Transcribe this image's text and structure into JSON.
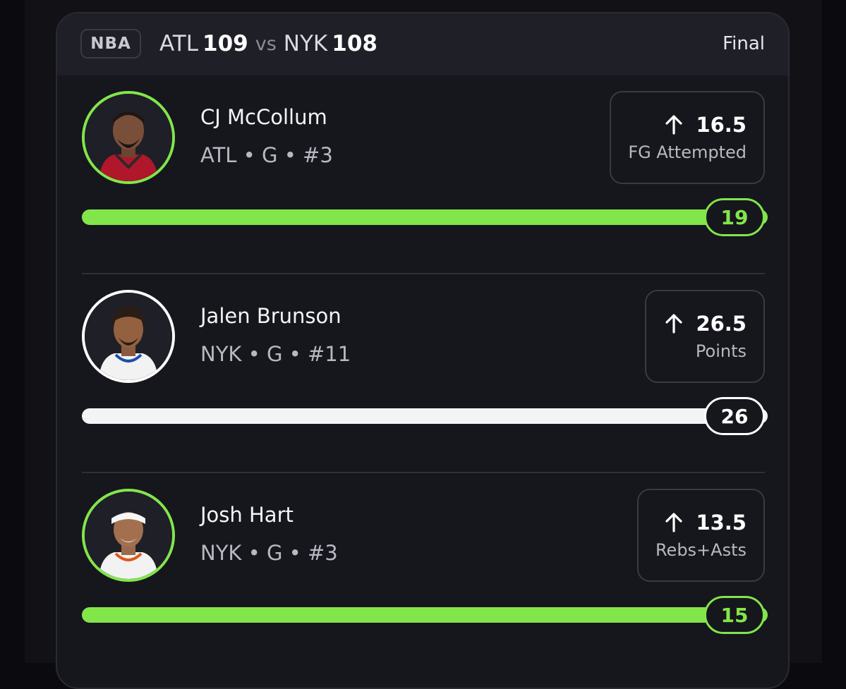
{
  "game": {
    "league": "NBA",
    "away_team": "ATL",
    "away_score": "109",
    "vs": "vs",
    "home_team": "NYK",
    "home_score": "108",
    "status": "Final"
  },
  "colors": {
    "hit": "#82e64a",
    "push": "#ffffff"
  },
  "players": [
    {
      "name": "CJ McCollum",
      "meta": "ATL • G • #3",
      "line": "16.5",
      "stat": "FG Attempted",
      "direction_icon": "arrow-up-icon",
      "result": "19",
      "result_state": "hit",
      "progress_fraction": 1.0
    },
    {
      "name": "Jalen Brunson",
      "meta": "NYK • G • #11",
      "line": "26.5",
      "stat": "Points",
      "direction_icon": "arrow-up-icon",
      "result": "26",
      "result_state": "miss",
      "progress_fraction": 1.0
    },
    {
      "name": "Josh Hart",
      "meta": "NYK • G • #3",
      "line": "13.5",
      "stat": "Rebs+Asts",
      "direction_icon": "arrow-up-icon",
      "result": "15",
      "result_state": "hit",
      "progress_fraction": 1.0
    }
  ]
}
